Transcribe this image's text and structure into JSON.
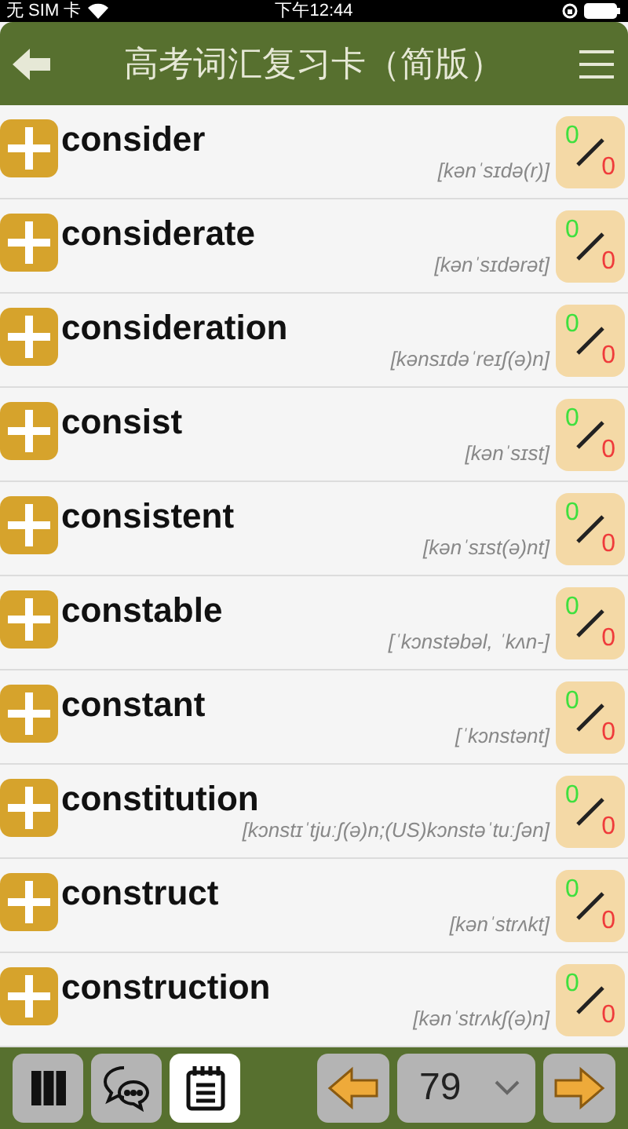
{
  "status_bar": {
    "carrier": "无 SIM 卡",
    "time": "下午12:44"
  },
  "header": {
    "title": "高考词汇复习卡（简版）"
  },
  "words": [
    {
      "word": "consider",
      "phonetic": "[kənˈsɪdə(r)]",
      "correct": "0",
      "wrong": "0"
    },
    {
      "word": "considerate",
      "phonetic": "[kənˈsɪdərət]",
      "correct": "0",
      "wrong": "0"
    },
    {
      "word": "consideration",
      "phonetic": "[kənsɪdəˈreɪʃ(ə)n]",
      "correct": "0",
      "wrong": "0"
    },
    {
      "word": "consist",
      "phonetic": "[kənˈsɪst]",
      "correct": "0",
      "wrong": "0"
    },
    {
      "word": "consistent",
      "phonetic": "[kənˈsɪst(ə)nt]",
      "correct": "0",
      "wrong": "0"
    },
    {
      "word": "constable",
      "phonetic": "[ˈkɔnstəbəl, ˈkʌn-]",
      "correct": "0",
      "wrong": "0"
    },
    {
      "word": "constant",
      "phonetic": "[ˈkɔnstənt]",
      "correct": "0",
      "wrong": "0"
    },
    {
      "word": "constitution",
      "phonetic": "[kɔnstɪˈtjuːʃ(ə)n;(US)kɔnstəˈtuːʃən]",
      "correct": "0",
      "wrong": "0"
    },
    {
      "word": "construct",
      "phonetic": "[kənˈstrʌkt]",
      "correct": "0",
      "wrong": "0"
    },
    {
      "word": "construction",
      "phonetic": "[kənˈstrʌkʃ(ə)n]",
      "correct": "0",
      "wrong": "0"
    }
  ],
  "toolbar": {
    "modes": [
      {
        "kind": "piano",
        "selected": false
      },
      {
        "kind": "chat",
        "selected": false
      },
      {
        "kind": "notepad",
        "selected": true
      }
    ],
    "page": "79"
  }
}
